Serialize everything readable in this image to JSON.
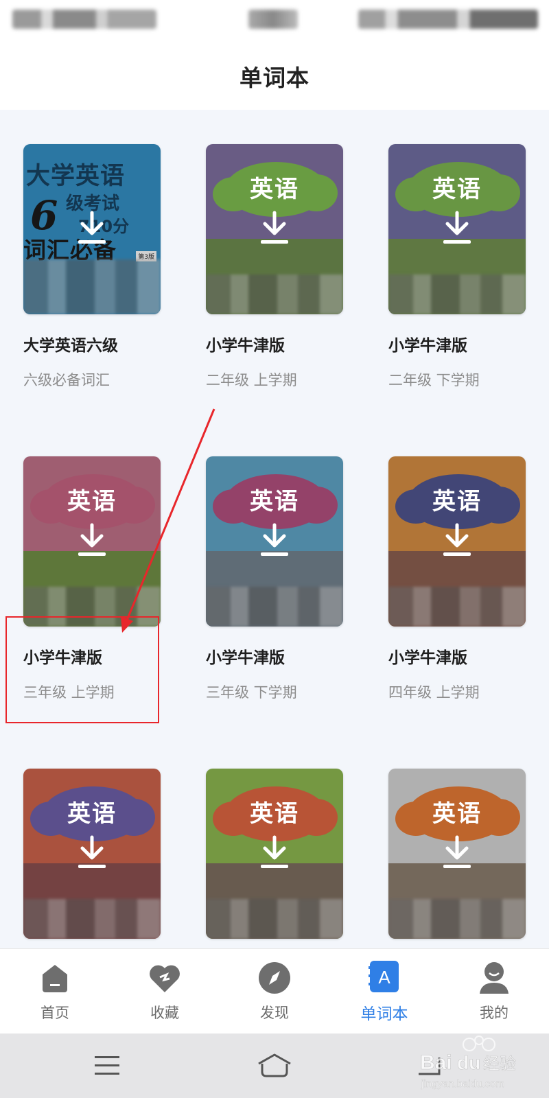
{
  "header": {
    "title": "单词本"
  },
  "books": [
    {
      "name": "大学英语六级",
      "desc": "六级必备词汇",
      "cover": {
        "style": "cet",
        "line1": "大学英语",
        "six": "6",
        "line2": "级考试",
        "line3": "710分",
        "line4": "词汇必备",
        "badge": "第3版"
      }
    },
    {
      "name": "小学牛津版",
      "desc": "二年级 上学期",
      "cover": {
        "style": "pep",
        "title": "英语",
        "sky": "#7b6b9e",
        "cloud": "#7cbd4a",
        "ground": "#6a8a48"
      }
    },
    {
      "name": "小学牛津版",
      "desc": "二年级 下学期",
      "cover": {
        "style": "pep",
        "title": "英语",
        "sky": "#6c6aa1",
        "cloud": "#7ab54b",
        "ground": "#6f8f4a"
      }
    },
    {
      "name": "小学牛津版",
      "desc": "三年级 上学期",
      "cover": {
        "style": "pep",
        "title": "英语",
        "sky": "#c16d86",
        "cloud": "#c75e7e",
        "ground": "#6e8e3f"
      }
    },
    {
      "name": "小学牛津版",
      "desc": "三年级 下学期",
      "cover": {
        "style": "pep",
        "title": "英语",
        "sky": "#5aa3c7",
        "cloud": "#b2497c",
        "ground": "#6f7f8c"
      }
    },
    {
      "name": "小学牛津版",
      "desc": "四年级 上学期",
      "cover": {
        "style": "pep",
        "title": "英语",
        "sky": "#d88b3b",
        "cloud": "#4a4f8c",
        "ground": "#8a5a4a"
      }
    },
    {
      "name": "",
      "desc": "",
      "cover": {
        "style": "pep",
        "title": "英语",
        "sky": "#cf5e45",
        "cloud": "#6a5aa8",
        "ground": "#8a4a4a"
      }
    },
    {
      "name": "",
      "desc": "",
      "cover": {
        "style": "pep",
        "title": "英语",
        "sky": "#8bb84a",
        "cloud": "#e0603a",
        "ground": "#7a6a5a"
      }
    },
    {
      "name": "",
      "desc": "",
      "cover": {
        "style": "pep",
        "title": "英语",
        "sky": "#d6d6d6",
        "cloud": "#e8772e",
        "ground": "#8a7a6a"
      }
    }
  ],
  "bottom_nav": [
    {
      "label": "首页",
      "icon": "home-icon",
      "active": false
    },
    {
      "label": "收藏",
      "icon": "heart-icon",
      "active": false
    },
    {
      "label": "发现",
      "icon": "compass-icon",
      "active": false
    },
    {
      "label": "单词本",
      "icon": "wordbook-icon",
      "active": true
    },
    {
      "label": "我的",
      "icon": "profile-icon",
      "active": false
    }
  ],
  "watermark": {
    "brand": "Bai du 经验",
    "url": "jingyan.baidu.com"
  },
  "colors": {
    "accent": "#2f7fe6",
    "annotation": "#e8262b"
  }
}
